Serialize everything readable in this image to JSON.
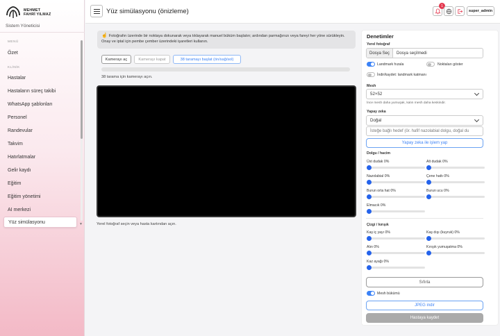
{
  "brand": {
    "line1": "MEHMET",
    "line2": "FAHRİ YILMAZ"
  },
  "role": "Sistem Yöneticisi",
  "sidebar": {
    "section_menu": "MENÜ",
    "section_clinic": "KLİNİK",
    "items": [
      {
        "label": "Özet"
      },
      {
        "label": "Hastalar"
      },
      {
        "label": "Hastaların süreç takibi"
      },
      {
        "label": "WhatsApp şablonları"
      },
      {
        "label": "Personel"
      },
      {
        "label": "Randevular"
      },
      {
        "label": "Takvim"
      },
      {
        "label": "Hatırlatmalar"
      },
      {
        "label": "Gelir kaydı"
      },
      {
        "label": "Eğitim"
      },
      {
        "label": "Eğitim yönetimi"
      },
      {
        "label": "AI merkezi"
      },
      {
        "label": "Yüz simülasyonu",
        "active": true
      }
    ]
  },
  "topbar": {
    "title": "Yüz simülasyonu (önizleme)",
    "notification_count": "1",
    "user": "super_admin"
  },
  "main": {
    "info_text": "Fotoğrafın üzerinde bir noktaya dokunarak veya tıklayarak manuel büküm başlatın; ardından parmağınızı veya fareyi her yöne sürükleyin. Onay ve iptal için pembe çember üzerindeki işaretleri kullanın.",
    "btn_camera_open": "Kamerayı aç",
    "btn_camera_close": "Kamerayı kapat",
    "btn_scan": "38 taramayı başlat (ön/sağ/sol)",
    "scan_progress": 0,
    "scan_status": "38 tarama için kamerayı açın.",
    "footer_hint": "Yerel fotoğraf seçin veya hasta kartından açın."
  },
  "panel": {
    "title": "Denetimler",
    "local_photo_label": "Yerel fotoğraf",
    "file_button": "Dosya Seç",
    "file_status": "Dosya seçilmedi",
    "toggle_landmark": {
      "label": "Landmark hızala",
      "on": true
    },
    "toggle_points": {
      "label": "Noktaları göster",
      "on": false
    },
    "toggle_save_landmark": {
      "label": "İndir/kaydet: landmark katmanı",
      "on": false
    },
    "mesh_label": "Mesh",
    "mesh_value": "52×52",
    "mesh_hint": "İnce mesh daha yumuşak, kalın mesh daha keskindir.",
    "ai_label": "Yapay zeka",
    "ai_value": "Doğal",
    "ai_placeholder": "İsteğe bağlı hedef (ör. hafif nazolabial dolgu, doğal du",
    "ai_button": "Yapay zeka ile işlem yap",
    "fill_section": "Dolgu / hacim",
    "fill_sliders": [
      {
        "label": "Üst dudak",
        "value": "0%"
      },
      {
        "label": "Alt dudak",
        "value": "0%"
      },
      {
        "label": "Nazolabial",
        "value": "0%"
      },
      {
        "label": "Çene hattı",
        "value": "0%"
      },
      {
        "label": "Burun orta hat",
        "value": "0%"
      },
      {
        "label": "Burun ucu",
        "value": "0%"
      },
      {
        "label": "Elmacık",
        "value": "0%"
      }
    ],
    "line_section": "Çizgi / kırışık",
    "line_sliders": [
      {
        "label": "Kaş iç yayı",
        "value": "0%"
      },
      {
        "label": "Kaş dışı (kuyruk)",
        "value": "0%"
      },
      {
        "label": "Alın",
        "value": "0%"
      },
      {
        "label": "Kırışık yumuşatma",
        "value": "0%"
      },
      {
        "label": "Kaz ayağı",
        "value": "0%"
      }
    ],
    "reset_button": "Sıfırla",
    "toggle_mesh_warp": {
      "label": "Mesh bükümü",
      "on": true
    },
    "jpeg_button": "JPEG indir",
    "save_button": "Hastaya kaydet"
  },
  "colors": {
    "accent": "#3b82f6",
    "badge": "#e53950",
    "canvas": "#000000"
  }
}
